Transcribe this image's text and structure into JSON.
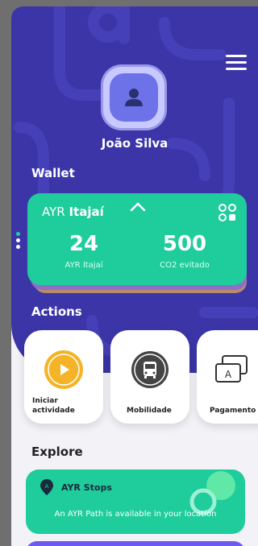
{
  "profile": {
    "name": "João Silva"
  },
  "sections": {
    "wallet": "Wallet",
    "actions": "Actions",
    "explore": "Explore"
  },
  "wallet": {
    "brand_prefix": "AYR",
    "brand_city": "Itajaí",
    "tokens_value": "24",
    "tokens_label_prefix": "AYR",
    "tokens_label_city": "Itajaí",
    "co2_value": "500",
    "co2_label": "CO2 evitado"
  },
  "actions": [
    {
      "label_line1": "Iniciar",
      "label_line2": "actividade",
      "icon": "play-icon"
    },
    {
      "label_line1": "Mobilidade",
      "label_line2": "",
      "icon": "bus-icon"
    },
    {
      "label_line1": "Pagamento",
      "label_line2": "",
      "icon": "payment-cards-icon"
    }
  ],
  "explore": {
    "stops_title": "AYR Stops",
    "stops_desc": "An AYR Path is available in your location"
  },
  "colors": {
    "primary": "#3b35a8",
    "accent": "#1fcc9c",
    "play": "#f5b427"
  }
}
